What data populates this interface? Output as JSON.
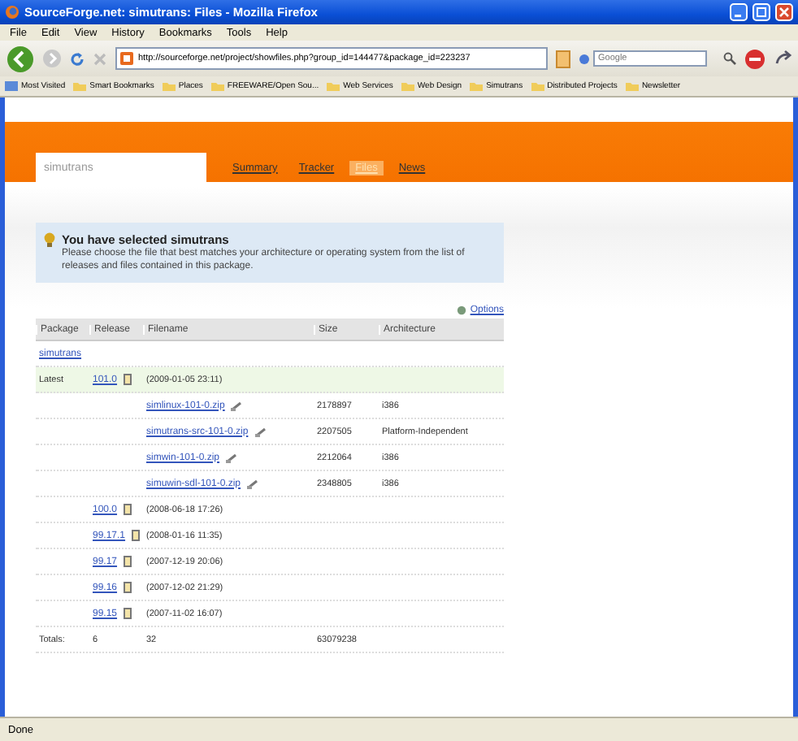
{
  "window": {
    "title": "SourceForge.net: simutrans: Files - Mozilla Firefox"
  },
  "menu": [
    "File",
    "Edit",
    "View",
    "History",
    "Bookmarks",
    "Tools",
    "Help"
  ],
  "toolbar": {
    "url": "http://sourceforge.net/project/showfiles.php?group_id=144477&package_id=223237",
    "search_placeholder": "Google"
  },
  "bookmarks": [
    "Most Visited",
    "Smart Bookmarks",
    "Places",
    "FREEWARE/Open Sou...",
    "Web Services",
    "Web Design",
    "Simutrans",
    "Distributed Projects",
    "Newsletter"
  ],
  "project_nav": {
    "project": "simutrans",
    "tabs": [
      {
        "label": "Summary",
        "selected": false
      },
      {
        "label": "Tracker",
        "selected": false
      },
      {
        "label": "Files",
        "selected": true
      },
      {
        "label": "News",
        "selected": false
      }
    ]
  },
  "notice": {
    "title": "You have selected simutrans",
    "message": "Please choose the file that best matches your architecture or operating system from the list of releases and files contained in this package."
  },
  "options_link": "Options",
  "table": {
    "columns": [
      "Package",
      "Release",
      "Filename",
      "Size",
      "Architecture"
    ],
    "rows": [
      {
        "kind": "package",
        "name": "simutrans"
      },
      {
        "kind": "release",
        "label": "Latest",
        "highlighted": true,
        "release": "101.0",
        "date": "(2009-01-05 23:11)"
      },
      {
        "kind": "file",
        "filename": "simlinux-101-0.zip",
        "size": "2178897",
        "arch": "i386"
      },
      {
        "kind": "file",
        "filename": "simutrans-src-101-0.zip",
        "size": "2207505",
        "arch": "Platform-Independent"
      },
      {
        "kind": "file",
        "filename": "simwin-101-0.zip",
        "size": "2212064",
        "arch": "i386"
      },
      {
        "kind": "file",
        "filename": "simuwin-sdl-101-0.zip",
        "size": "2348805",
        "arch": "i386"
      },
      {
        "kind": "release",
        "highlighted": false,
        "release": "100.0",
        "date": "(2008-06-18 17:26)"
      },
      {
        "kind": "release",
        "highlighted": false,
        "release": "99.17.1",
        "date": "(2008-01-16 11:35)"
      },
      {
        "kind": "release",
        "highlighted": false,
        "release": "99.17",
        "date": "(2007-12-19 20:06)"
      },
      {
        "kind": "release",
        "highlighted": false,
        "release": "99.16",
        "date": "(2007-12-02 21:29)"
      },
      {
        "kind": "release",
        "highlighted": false,
        "release": "99.15",
        "date": "(2007-11-02 16:07)"
      },
      {
        "kind": "total",
        "label": "Totals:",
        "releases": "6",
        "files": "32",
        "size": "63079238"
      }
    ]
  },
  "status_bar": "Done"
}
